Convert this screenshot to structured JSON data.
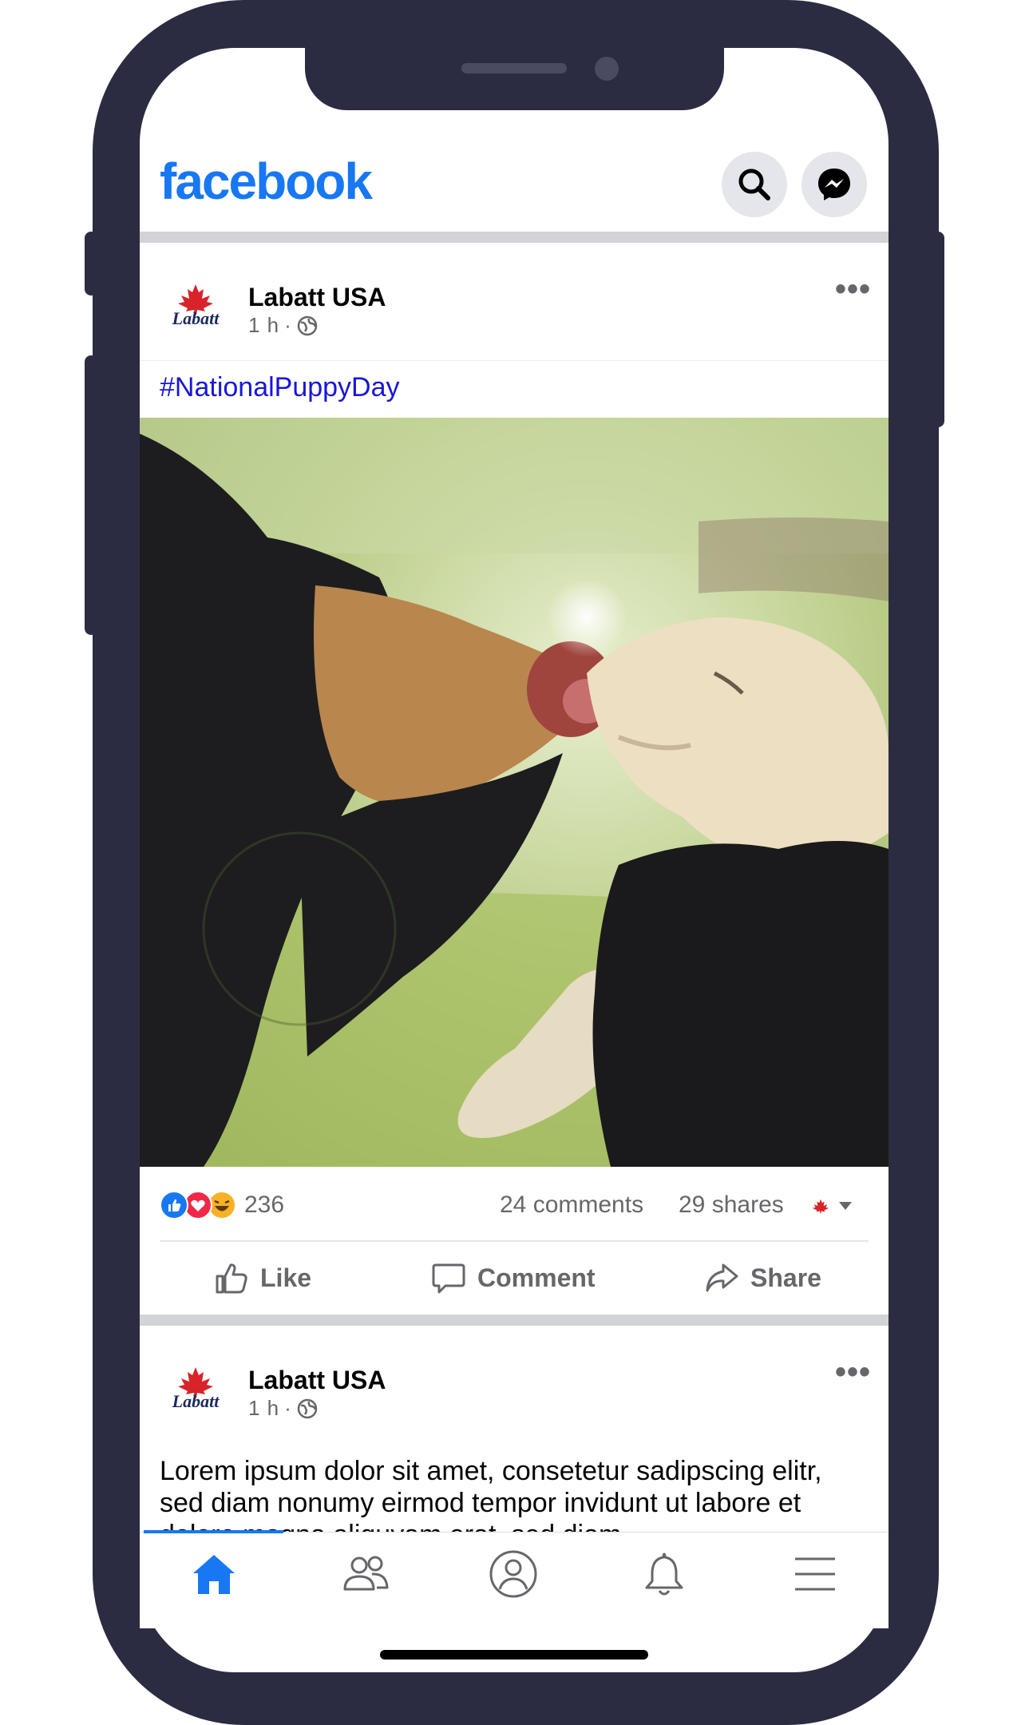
{
  "app": {
    "logo_text": "facebook",
    "brand_color": "#1877f2"
  },
  "header": {
    "search_icon": "search-icon",
    "messenger_icon": "messenger-icon"
  },
  "posts": [
    {
      "author": "Labatt USA",
      "time": "1 h",
      "separator": "·",
      "privacy_icon": "globe-icon",
      "avatar_logo_text": "Labatt",
      "hashtag": "#NationalPuppyDay",
      "reaction_count": "236",
      "comments": "24 comments",
      "shares": "29 shares"
    },
    {
      "author": "Labatt USA",
      "time": "1 h",
      "separator": "·",
      "privacy_icon": "globe-icon",
      "avatar_logo_text": "Labatt",
      "text": "Lorem ipsum dolor sit amet, consetetur sadipscing elitr, sed diam nonumy eirmod tempor invidunt ut labore et dolore magna aliquyam erat, sed diam"
    }
  ],
  "actions": {
    "like": "Like",
    "comment": "Comment",
    "share": "Share"
  },
  "nav": {
    "items": [
      {
        "icon": "home-icon",
        "active": true
      },
      {
        "icon": "friends-icon",
        "active": false
      },
      {
        "icon": "profile-icon",
        "active": false
      },
      {
        "icon": "bell-icon",
        "active": false
      },
      {
        "icon": "menu-icon",
        "active": false
      }
    ]
  }
}
